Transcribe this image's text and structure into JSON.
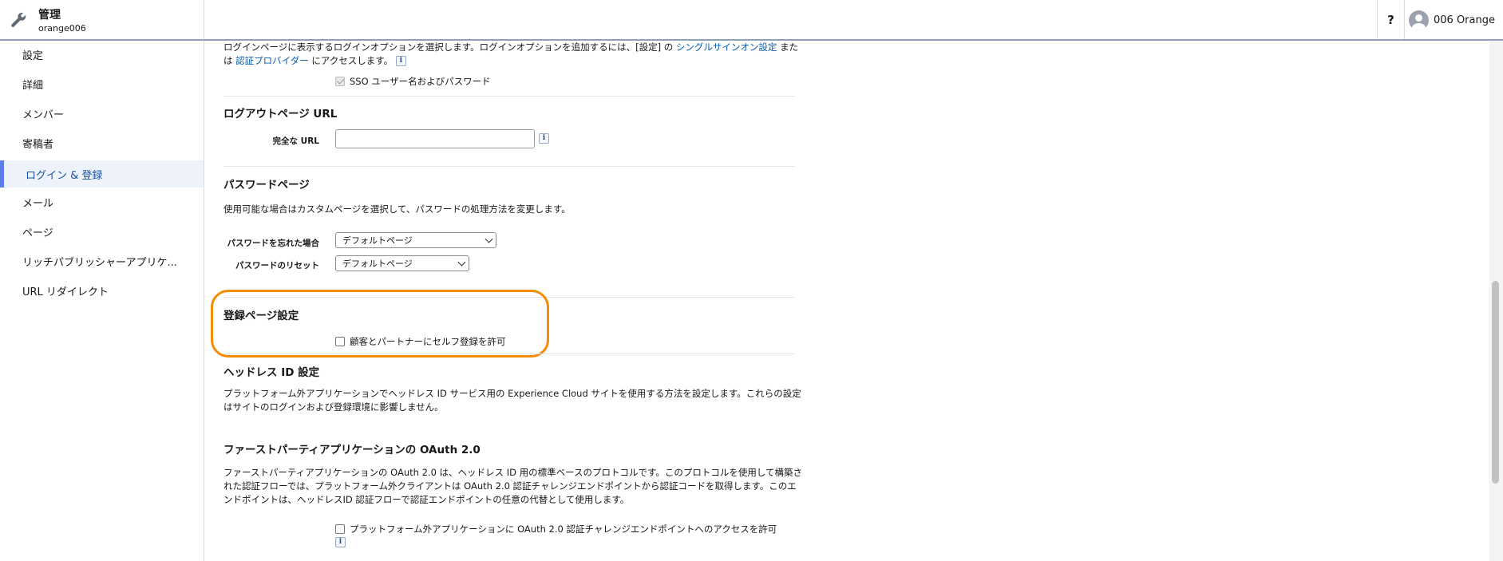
{
  "header": {
    "title": "管理",
    "subtitle": "orange006",
    "help": "?",
    "user_name": "006 Orange"
  },
  "sidebar": {
    "items": [
      {
        "label": "設定",
        "active": false
      },
      {
        "label": "詳細",
        "active": false
      },
      {
        "label": "メンバー",
        "active": false
      },
      {
        "label": "寄稿者",
        "active": false
      },
      {
        "label": "ログイン & 登録",
        "active": true
      },
      {
        "label": "メール",
        "active": false
      },
      {
        "label": "ページ",
        "active": false
      },
      {
        "label": "リッチパブリッシャーアプリケ...",
        "active": false
      },
      {
        "label": "URL リダイレクト",
        "active": false
      }
    ]
  },
  "login_options": {
    "desc_part1": "ログインページに表示するログインオプションを選択します。ログインオプションを追加するには、[設定] の",
    "link1": "シングルサインオン設定",
    "desc_part2": "また",
    "desc_part3": "は",
    "link2": "認証プロバイダー",
    "desc_part4": "にアクセスします。",
    "sso_label": "SSO ユーザー名およびパスワード"
  },
  "logout": {
    "title": "ログアウトページ URL",
    "url_label": "完全な URL",
    "url_value": ""
  },
  "password": {
    "title": "パスワードページ",
    "desc": "使用可能な場合はカスタムページを選択して、パスワードの処理方法を変更します。",
    "forgot_label": "パスワードを忘れた場合",
    "forgot_value": "デフォルトページ",
    "reset_label": "パスワードのリセット",
    "reset_value": "デフォルトページ"
  },
  "registration": {
    "title": "登録ページ設定",
    "self_reg_label": "顧客とパートナーにセルフ登録を許可"
  },
  "headless": {
    "title": "ヘッドレス ID 設定",
    "desc_line1": "プラットフォーム外アプリケーションでヘッドレス ID サービス用の Experience Cloud サイトを使用する方法を設定します。これらの設定",
    "desc_line2": "はサイトのログインおよび登録環境に影響しません。"
  },
  "oauth": {
    "title": "ファーストパーティアプリケーションの OAuth 2.0",
    "desc_line1": "ファーストパーティアプリケーションの OAuth 2.0 は、ヘッドレス ID 用の標準ベースのプロトコルです。このプロトコルを使用して構築さ",
    "desc_line2": "れた認証フローでは、プラットフォーム外クライアントは OAuth 2.0 認証チャレンジエンドポイントから認証コードを取得します。このエ",
    "desc_line3": "ンドポイントは、ヘッドレスID 認証フローで認証エンドポイントの任意の代替として使用します。",
    "allow_label": "プラットフォーム外アプリケーションに OAuth 2.0 認証チャレンジエンドポイントへのアクセスを許可"
  },
  "info_glyph": "i",
  "colors": {
    "accent": "#5b7fe6",
    "highlight": "#f48c06",
    "link": "#0b5cab"
  }
}
